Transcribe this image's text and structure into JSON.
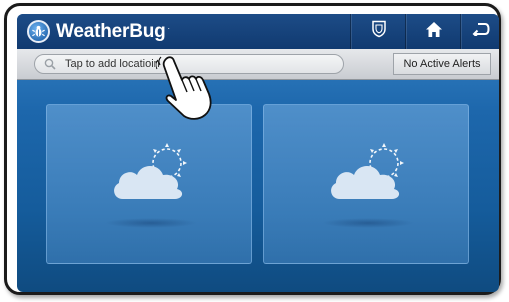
{
  "app": {
    "logo_text": "WeatherBug",
    "logo_tm": "."
  },
  "toolbar": {
    "buttons": [
      {
        "name": "alerts-shield-button",
        "icon": "shield-icon"
      },
      {
        "name": "home-button",
        "icon": "home-icon"
      },
      {
        "name": "back-button",
        "icon": "back-arrow-icon"
      }
    ]
  },
  "search": {
    "placeholder": "Tap to add locatioin"
  },
  "alerts": {
    "label": "No Active Alerts"
  },
  "cards": [
    {
      "name": "weather-card-1",
      "icon": "partly-cloudy-icon"
    },
    {
      "name": "weather-card-2",
      "icon": "partly-cloudy-icon"
    }
  ],
  "colors": {
    "topbar": "#103a70",
    "screen_bg": "#1d67ac",
    "subbar": "#d4d7db"
  }
}
